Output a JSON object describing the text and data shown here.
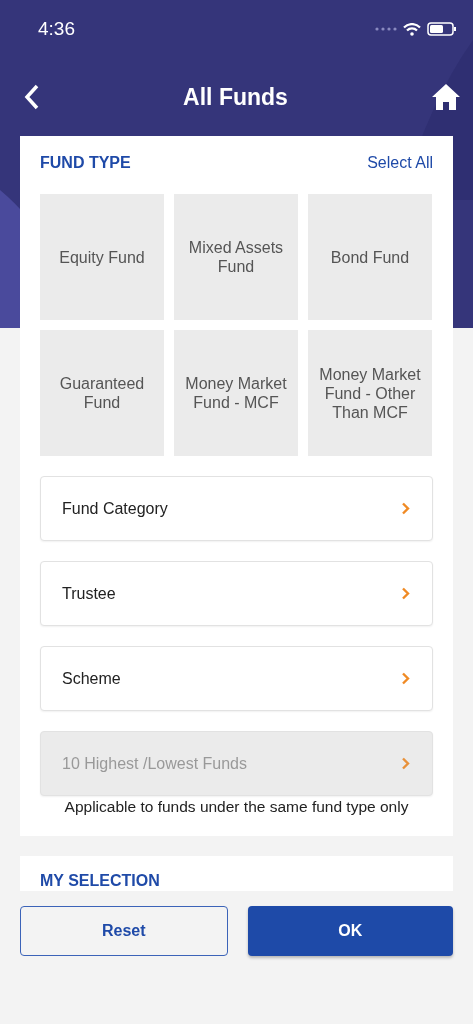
{
  "status_bar": {
    "time": "4:36"
  },
  "header": {
    "title": "All Funds"
  },
  "fund_type": {
    "title": "FUND TYPE",
    "select_all": "Select All",
    "tiles": [
      {
        "label": "Equity Fund",
        "selected": false
      },
      {
        "label": "Mixed Assets Fund",
        "selected": false
      },
      {
        "label": "Bond Fund",
        "selected": false
      },
      {
        "label": "Guaranteed Fund",
        "selected": false
      },
      {
        "label": "Money Market Fund - MCF",
        "selected": false
      },
      {
        "label": "Money Market Fund - Other Than MCF",
        "selected": false
      }
    ],
    "filters": [
      {
        "label": "Fund Category",
        "disabled": false
      },
      {
        "label": "Trustee",
        "disabled": false
      },
      {
        "label": "Scheme",
        "disabled": false
      },
      {
        "label": "10 Highest /Lowest Funds",
        "disabled": true
      }
    ],
    "note": "Applicable to funds under the same fund type only"
  },
  "my_selection": {
    "title": "MY SELECTION"
  },
  "buttons": [
    {
      "label": "Reset",
      "kind": "secondary"
    },
    {
      "label": "OK",
      "kind": "primary"
    }
  ]
}
